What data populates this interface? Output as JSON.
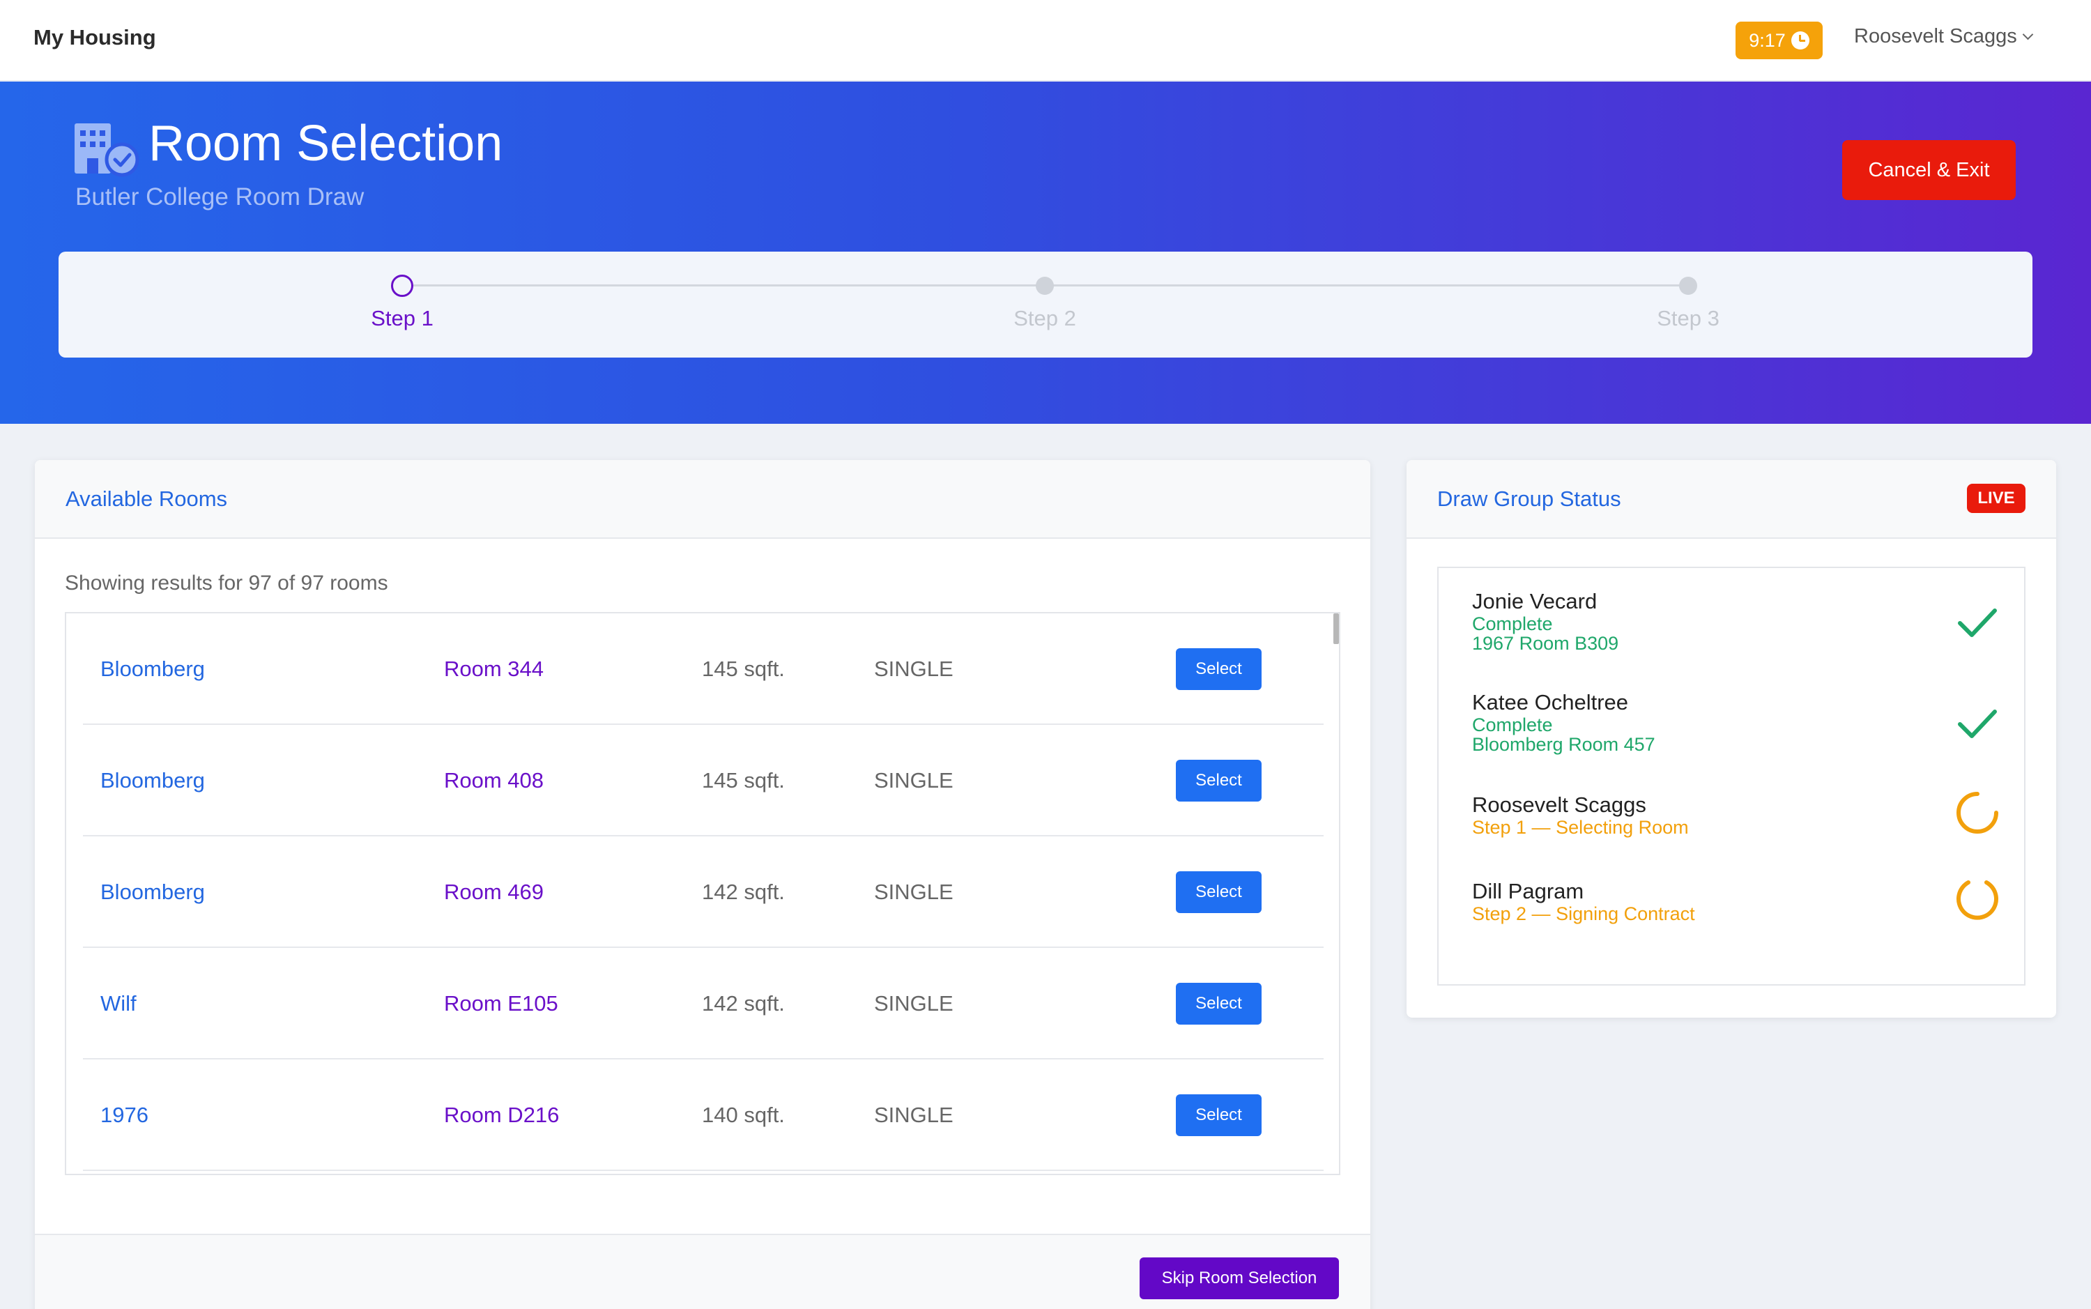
{
  "navbar": {
    "brand": "My Housing",
    "timer": "9:17",
    "timer_icon": "clock-icon",
    "user_name": "Roosevelt Scaggs"
  },
  "hero": {
    "title": "Room Selection",
    "subtitle": "Butler College Room Draw",
    "cancel_label": "Cancel & Exit",
    "icon": "building-check-icon"
  },
  "steps": [
    {
      "label": "Step 1",
      "active": true
    },
    {
      "label": "Step 2",
      "active": false
    },
    {
      "label": "Step 3",
      "active": false
    }
  ],
  "rooms_panel": {
    "title": "Available Rooms",
    "results_text": "Showing results for 97 of 97 rooms",
    "select_label": "Select",
    "skip_label": "Skip Room Selection",
    "rooms": [
      {
        "building": "Bloomberg",
        "room": "Room 344",
        "size": "145 sqft.",
        "type": "SINGLE"
      },
      {
        "building": "Bloomberg",
        "room": "Room 408",
        "size": "145 sqft.",
        "type": "SINGLE"
      },
      {
        "building": "Bloomberg",
        "room": "Room 469",
        "size": "142 sqft.",
        "type": "SINGLE"
      },
      {
        "building": "Wilf",
        "room": "Room E105",
        "size": "142 sqft.",
        "type": "SINGLE"
      },
      {
        "building": "1976",
        "room": "Room D216",
        "size": "140 sqft.",
        "type": "SINGLE"
      }
    ]
  },
  "status_panel": {
    "title": "Draw Group Status",
    "live_label": "LIVE",
    "members": [
      {
        "name": "Jonie Vecard",
        "status": "Complete",
        "detail": "1967 Room B309",
        "state": "complete",
        "icon": "check-icon"
      },
      {
        "name": "Katee Ocheltree",
        "status": "Complete",
        "detail": "Bloomberg Room 457",
        "state": "complete",
        "icon": "check-icon"
      },
      {
        "name": "Roosevelt Scaggs",
        "status": "Step 1 — Selecting Room",
        "detail": "",
        "state": "pending",
        "icon": "spinner-icon"
      },
      {
        "name": "Dill Pagram",
        "status": "Step 2 — Signing Contract",
        "detail": "",
        "state": "pending",
        "icon": "spinner-icon"
      }
    ]
  },
  "colors": {
    "accent_blue": "#2367e0",
    "accent_purple": "#6a10c9",
    "danger": "#e91b0c",
    "warning": "#f5a20a",
    "success": "#1fa76a"
  }
}
